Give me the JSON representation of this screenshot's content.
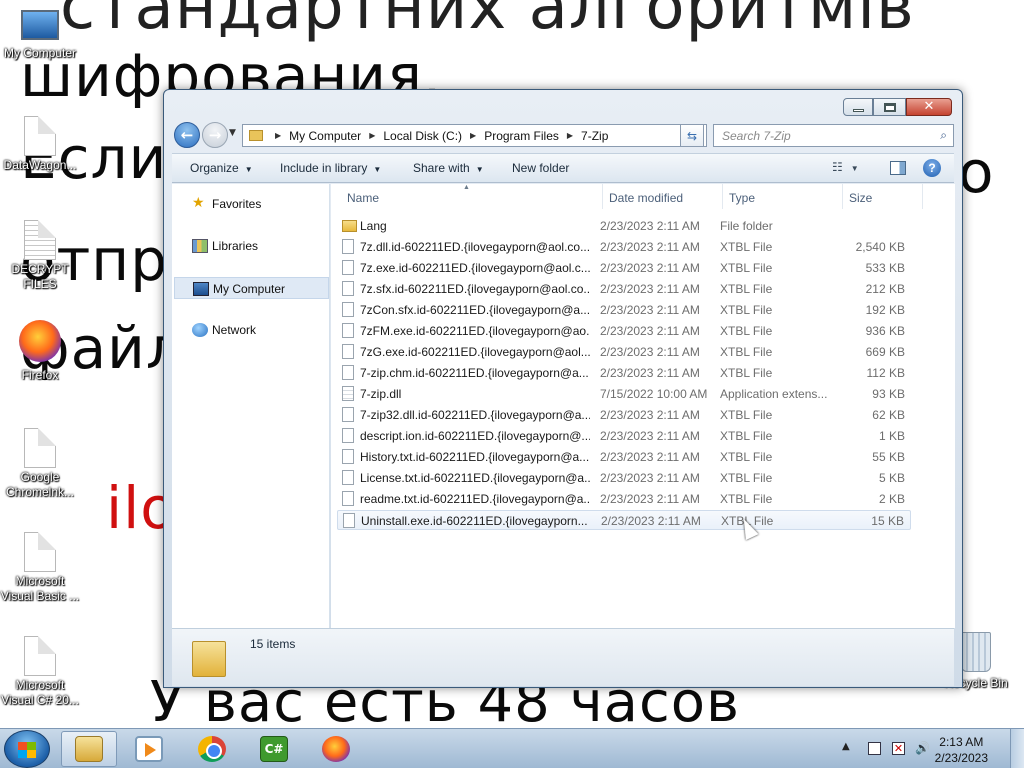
{
  "wallpaper": {
    "line1": "стандартних алгоритмів",
    "line2": "шифрования.",
    "line3": "Если",
    "line3r": "о",
    "line4": "отпра",
    "line5": "файл",
    "line6": "ilo",
    "line7": "У вас есть 48 часов"
  },
  "desktop_icons": [
    {
      "label": "My Computer"
    },
    {
      "label": "DataWagon..."
    },
    {
      "label": "DECRYPT FILES"
    },
    {
      "label": "Firefox"
    },
    {
      "label": "Google Chromelnk..."
    },
    {
      "label": "Microsoft Visual Basic ..."
    },
    {
      "label": "Microsoft Visual C# 20..."
    },
    {
      "label": "Recycle Bin"
    }
  ],
  "window": {
    "address": [
      "My Computer",
      "Local Disk (C:)",
      "Program Files",
      "7-Zip"
    ],
    "search_placeholder": "Search 7-Zip",
    "toolbar": {
      "organize": "Organize",
      "include": "Include in library",
      "share": "Share with",
      "new_folder": "New folder"
    },
    "nav": {
      "favorites": "Favorites",
      "libraries": "Libraries",
      "computer": "My Computer",
      "network": "Network"
    },
    "columns": {
      "name": "Name",
      "date": "Date modified",
      "type": "Type",
      "size": "Size"
    },
    "files": [
      {
        "name": "Lang",
        "date": "2/23/2023 2:11 AM",
        "type": "File folder",
        "size": "",
        "icon": "folder-icon"
      },
      {
        "name": "7z.dll.id-602211ED.{ilovegayporn@aol.co...",
        "date": "2/23/2023 2:11 AM",
        "type": "XTBL File",
        "size": "2,540 KB",
        "icon": "file-icon"
      },
      {
        "name": "7z.exe.id-602211ED.{ilovegayporn@aol.c...",
        "date": "2/23/2023 2:11 AM",
        "type": "XTBL File",
        "size": "533 KB",
        "icon": "file-icon"
      },
      {
        "name": "7z.sfx.id-602211ED.{ilovegayporn@aol.co...",
        "date": "2/23/2023 2:11 AM",
        "type": "XTBL File",
        "size": "212 KB",
        "icon": "file-icon"
      },
      {
        "name": "7zCon.sfx.id-602211ED.{ilovegayporn@a...",
        "date": "2/23/2023 2:11 AM",
        "type": "XTBL File",
        "size": "192 KB",
        "icon": "file-icon"
      },
      {
        "name": "7zFM.exe.id-602211ED.{ilovegayporn@ao...",
        "date": "2/23/2023 2:11 AM",
        "type": "XTBL File",
        "size": "936 KB",
        "icon": "file-icon"
      },
      {
        "name": "7zG.exe.id-602211ED.{ilovegayporn@aol....",
        "date": "2/23/2023 2:11 AM",
        "type": "XTBL File",
        "size": "669 KB",
        "icon": "file-icon"
      },
      {
        "name": "7-zip.chm.id-602211ED.{ilovegayporn@a...",
        "date": "2/23/2023 2:11 AM",
        "type": "XTBL File",
        "size": "112 KB",
        "icon": "file-icon"
      },
      {
        "name": "7-zip.dll",
        "date": "7/15/2022 10:00 AM",
        "type": "Application extens...",
        "size": "93 KB",
        "icon": "dll-icon"
      },
      {
        "name": "7-zip32.dll.id-602211ED.{ilovegayporn@a...",
        "date": "2/23/2023 2:11 AM",
        "type": "XTBL File",
        "size": "62 KB",
        "icon": "file-icon"
      },
      {
        "name": "descript.ion.id-602211ED.{ilovegayporn@...",
        "date": "2/23/2023 2:11 AM",
        "type": "XTBL File",
        "size": "1 KB",
        "icon": "file-icon"
      },
      {
        "name": "History.txt.id-602211ED.{ilovegayporn@a...",
        "date": "2/23/2023 2:11 AM",
        "type": "XTBL File",
        "size": "55 KB",
        "icon": "file-icon"
      },
      {
        "name": "License.txt.id-602211ED.{ilovegayporn@a...",
        "date": "2/23/2023 2:11 AM",
        "type": "XTBL File",
        "size": "5 KB",
        "icon": "file-icon"
      },
      {
        "name": "readme.txt.id-602211ED.{ilovegayporn@a...",
        "date": "2/23/2023 2:11 AM",
        "type": "XTBL File",
        "size": "2 KB",
        "icon": "file-icon"
      },
      {
        "name": "Uninstall.exe.id-602211ED.{ilovegayporn...",
        "date": "2/23/2023 2:11 AM",
        "type": "XTBL File",
        "size": "15 KB",
        "icon": "file-icon"
      }
    ],
    "item_count": "15 items"
  },
  "taskbar": {
    "time": "2:13 AM",
    "date": "2/23/2023",
    "apps": [
      "windows-explorer",
      "media-player",
      "chrome",
      "csharp-ide",
      "firefox"
    ],
    "cs_label": "C#"
  }
}
